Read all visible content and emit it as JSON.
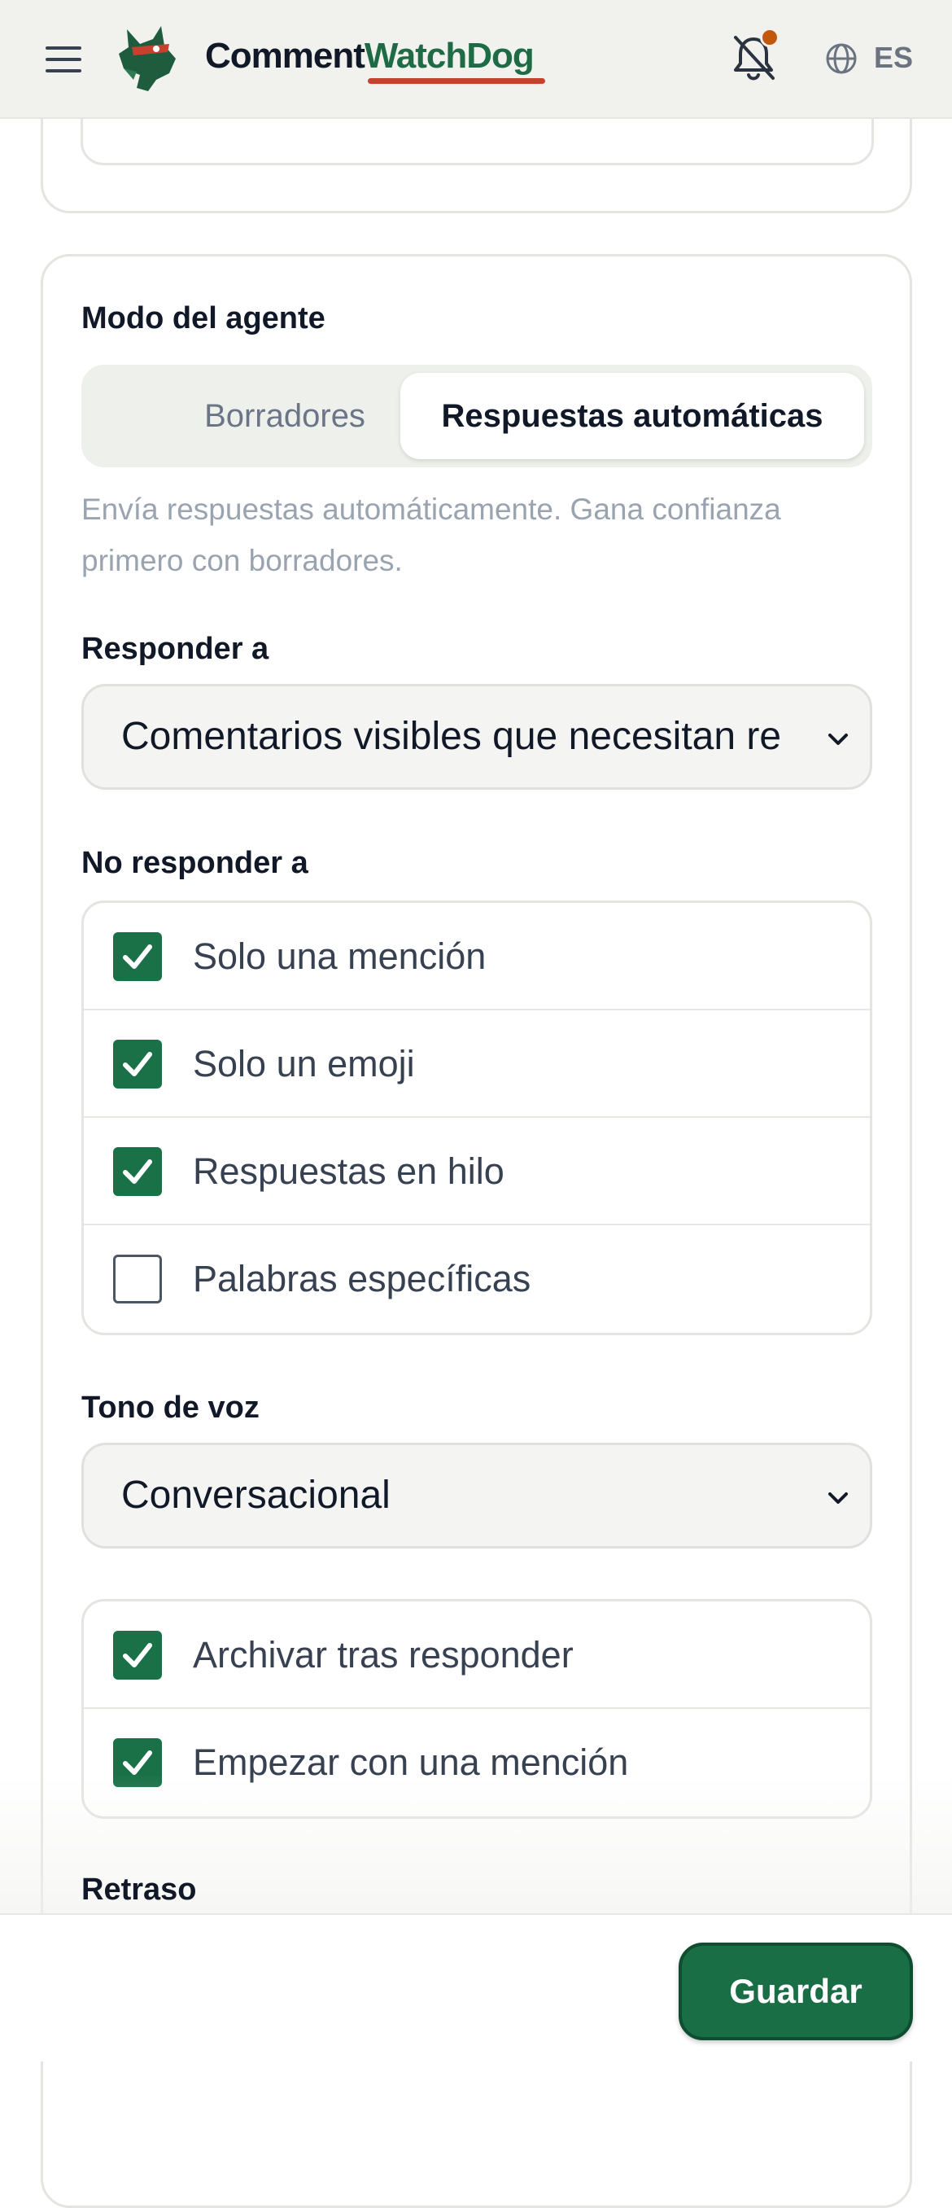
{
  "header": {
    "brand_part1": "Comment",
    "brand_part2": "WatchDog",
    "language": "ES",
    "notification_dot_color": "#c2570b",
    "icons": [
      "menu-icon",
      "dog-logo-icon",
      "bell-off-icon",
      "globe-icon"
    ]
  },
  "agent_mode": {
    "label": "Modo del agente",
    "options": [
      "Borradores",
      "Respuestas automáticas"
    ],
    "selected": "Respuestas automáticas",
    "helper": "Envía respuestas automáticamente. Gana confianza primero con borradores."
  },
  "respond_to": {
    "label": "Responder a",
    "value": "Comentarios visibles que necesitan re"
  },
  "do_not_respond": {
    "label": "No responder a",
    "items": [
      {
        "label": "Solo una mención",
        "checked": true
      },
      {
        "label": "Solo un emoji",
        "checked": true
      },
      {
        "label": "Respuestas en hilo",
        "checked": true
      },
      {
        "label": "Palabras específicas",
        "checked": false
      }
    ]
  },
  "tone": {
    "label": "Tono de voz",
    "value": "Conversacional"
  },
  "options": {
    "items": [
      {
        "label": "Archivar tras responder",
        "checked": true
      },
      {
        "label": "Empezar con una mención",
        "checked": true
      }
    ]
  },
  "delay": {
    "label": "Retraso"
  },
  "footer": {
    "save_label": "Guardar"
  },
  "colors": {
    "accent": "#1a7148",
    "brand_green": "#1f6b45",
    "underline_red": "#c8412f"
  }
}
